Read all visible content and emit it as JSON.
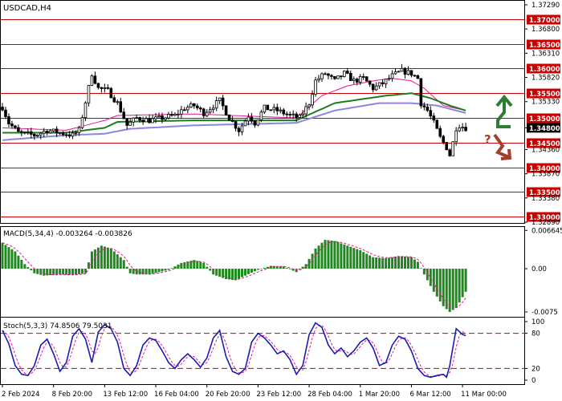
{
  "chart_data": {
    "type": "candlestick",
    "symbol": "USDCAD,H4",
    "main": {
      "ylim": [
        1.3289,
        1.3729
      ],
      "y_ticks": [
        "1.37290",
        "1.36800",
        "1.36310",
        "1.35820",
        "1.35330",
        "1.34800",
        "1.34360",
        "1.33870",
        "1.33380",
        "1.32890"
      ],
      "current_price": "1.34800",
      "levels": [
        {
          "value": 1.37,
          "label": "1.37000"
        },
        {
          "value": 1.365,
          "label": "1.36500"
        },
        {
          "value": 1.36,
          "label": "1.36000"
        },
        {
          "value": 1.355,
          "label": "1.35500"
        },
        {
          "value": 1.35,
          "label": "1.35000"
        },
        {
          "value": 1.345,
          "label": "1.34500"
        },
        {
          "value": 1.34,
          "label": "1.34000"
        },
        {
          "value": 1.335,
          "label": "1.33500"
        },
        {
          "value": 1.33,
          "label": "1.33000"
        }
      ],
      "close_anchors": [
        [
          0,
          1.3522
        ],
        [
          2,
          1.349
        ],
        [
          5,
          1.347
        ],
        [
          10,
          1.3465
        ],
        [
          14,
          1.3475
        ],
        [
          18,
          1.347
        ],
        [
          22,
          1.3465
        ],
        [
          24,
          1.3475
        ],
        [
          28,
          1.359
        ],
        [
          30,
          1.356
        ],
        [
          33,
          1.3555
        ],
        [
          36,
          1.353
        ],
        [
          39,
          1.3485
        ],
        [
          42,
          1.35
        ],
        [
          46,
          1.3495
        ],
        [
          50,
          1.35
        ],
        [
          54,
          1.3505
        ],
        [
          57,
          1.352
        ],
        [
          60,
          1.3525
        ],
        [
          63,
          1.351
        ],
        [
          66,
          1.3525
        ],
        [
          68,
          1.3535
        ],
        [
          71,
          1.35
        ],
        [
          74,
          1.3475
        ],
        [
          77,
          1.3505
        ],
        [
          79,
          1.349
        ],
        [
          82,
          1.352
        ],
        [
          86,
          1.3515
        ],
        [
          90,
          1.3505
        ],
        [
          93,
          1.35
        ],
        [
          96,
          1.353
        ],
        [
          98,
          1.3575
        ],
        [
          101,
          1.359
        ],
        [
          104,
          1.3575
        ],
        [
          107,
          1.359
        ],
        [
          110,
          1.3575
        ],
        [
          113,
          1.358
        ],
        [
          116,
          1.356
        ],
        [
          119,
          1.357
        ],
        [
          122,
          1.3585
        ],
        [
          125,
          1.3595
        ],
        [
          128,
          1.359
        ],
        [
          130,
          1.358
        ],
        [
          131,
          1.353
        ],
        [
          133,
          1.3515
        ],
        [
          135,
          1.349
        ],
        [
          137,
          1.346
        ],
        [
          139,
          1.344
        ],
        [
          140,
          1.3425
        ],
        [
          141,
          1.345
        ],
        [
          142,
          1.348
        ],
        [
          143,
          1.3485
        ],
        [
          145,
          1.348
        ]
      ],
      "ma_anchors": [
        {
          "name": "ma-red",
          "color": "#e8168e",
          "points": [
            [
              0,
              1.348
            ],
            [
              20,
              1.3475
            ],
            [
              32,
              1.3495
            ],
            [
              36,
              1.3505
            ],
            [
              60,
              1.3508
            ],
            [
              92,
              1.35
            ],
            [
              100,
              1.3545
            ],
            [
              108,
              1.3565
            ],
            [
              116,
              1.3575
            ],
            [
              122,
              1.358
            ],
            [
              128,
              1.3575
            ],
            [
              132,
              1.356
            ],
            [
              138,
              1.3525
            ],
            [
              145,
              1.3515
            ]
          ]
        },
        {
          "name": "ma-green",
          "color": "#1e7d1e",
          "points": [
            [
              0,
              1.347
            ],
            [
              20,
              1.347
            ],
            [
              32,
              1.348
            ],
            [
              36,
              1.3492
            ],
            [
              60,
              1.3495
            ],
            [
              92,
              1.3495
            ],
            [
              104,
              1.353
            ],
            [
              120,
              1.3545
            ],
            [
              128,
              1.355
            ],
            [
              134,
              1.354
            ],
            [
              140,
              1.3525
            ],
            [
              145,
              1.3515
            ]
          ]
        },
        {
          "name": "ma-blue",
          "color": "#8a86e0",
          "points": [
            [
              0,
              1.3455
            ],
            [
              20,
              1.3465
            ],
            [
              32,
              1.3468
            ],
            [
              40,
              1.3478
            ],
            [
              60,
              1.3485
            ],
            [
              92,
              1.349
            ],
            [
              104,
              1.3515
            ],
            [
              118,
              1.353
            ],
            [
              128,
              1.353
            ],
            [
              136,
              1.3525
            ],
            [
              145,
              1.351
            ]
          ]
        }
      ],
      "signal_up": "up-arrow",
      "signal_down": "down-arrow",
      "signal_question": "?"
    },
    "macd": {
      "label": "MACD(5,34,4) -0.003264 -0.003826",
      "ylim": [
        -0.0082,
        0.0071
      ],
      "y_ticks": [
        "0.006645",
        "0.00",
        "-0.0075"
      ],
      "bar_color": "#1e8a1e",
      "signal_color": "#e8168e",
      "anchors": [
        [
          0,
          0.0045
        ],
        [
          4,
          0.003
        ],
        [
          7,
          0.0008
        ],
        [
          10,
          -0.0008
        ],
        [
          13,
          -0.0012
        ],
        [
          18,
          -0.001
        ],
        [
          22,
          -0.0011
        ],
        [
          26,
          -0.0008
        ],
        [
          28,
          0.003
        ],
        [
          31,
          0.004
        ],
        [
          34,
          0.0035
        ],
        [
          38,
          0.0015
        ],
        [
          40,
          -0.0008
        ],
        [
          42,
          -0.001
        ],
        [
          46,
          -0.001
        ],
        [
          52,
          -0.0002
        ],
        [
          56,
          0.001
        ],
        [
          60,
          0.0015
        ],
        [
          63,
          0.001
        ],
        [
          66,
          -0.001
        ],
        [
          70,
          -0.0018
        ],
        [
          73,
          -0.002
        ],
        [
          76,
          -0.0012
        ],
        [
          80,
          -0.0002
        ],
        [
          84,
          0.0005
        ],
        [
          88,
          0.0004
        ],
        [
          92,
          -0.0006
        ],
        [
          95,
          0.0008
        ],
        [
          98,
          0.0035
        ],
        [
          101,
          0.005
        ],
        [
          104,
          0.0048
        ],
        [
          108,
          0.004
        ],
        [
          112,
          0.0032
        ],
        [
          116,
          0.002
        ],
        [
          120,
          0.0018
        ],
        [
          124,
          0.0022
        ],
        [
          128,
          0.002
        ],
        [
          130,
          0.0012
        ],
        [
          132,
          -0.001
        ],
        [
          135,
          -0.004
        ],
        [
          138,
          -0.0065
        ],
        [
          140,
          -0.0075
        ],
        [
          142,
          -0.0068
        ],
        [
          145,
          -0.004
        ]
      ]
    },
    "stoch": {
      "label": "Stoch(5,3,3) 74.8506 79.5031",
      "ylim": [
        0,
        100
      ],
      "y_ticks": [
        "100",
        "80",
        "20",
        "0"
      ],
      "levels": [
        80,
        20
      ],
      "k_color": "#1b1bb5",
      "d_color": "#e8168e",
      "anchors": [
        [
          0,
          85
        ],
        [
          2,
          62
        ],
        [
          4,
          25
        ],
        [
          6,
          10
        ],
        [
          8,
          8
        ],
        [
          10,
          25
        ],
        [
          12,
          60
        ],
        [
          14,
          70
        ],
        [
          16,
          45
        ],
        [
          18,
          15
        ],
        [
          20,
          30
        ],
        [
          22,
          75
        ],
        [
          24,
          88
        ],
        [
          26,
          70
        ],
        [
          28,
          30
        ],
        [
          30,
          82
        ],
        [
          32,
          95
        ],
        [
          34,
          88
        ],
        [
          36,
          65
        ],
        [
          38,
          20
        ],
        [
          40,
          8
        ],
        [
          42,
          25
        ],
        [
          44,
          60
        ],
        [
          46,
          72
        ],
        [
          48,
          68
        ],
        [
          50,
          50
        ],
        [
          52,
          30
        ],
        [
          54,
          20
        ],
        [
          56,
          35
        ],
        [
          58,
          45
        ],
        [
          60,
          35
        ],
        [
          62,
          22
        ],
        [
          64,
          38
        ],
        [
          66,
          72
        ],
        [
          68,
          85
        ],
        [
          70,
          40
        ],
        [
          72,
          15
        ],
        [
          74,
          10
        ],
        [
          76,
          20
        ],
        [
          78,
          65
        ],
        [
          80,
          80
        ],
        [
          82,
          72
        ],
        [
          84,
          60
        ],
        [
          86,
          45
        ],
        [
          88,
          50
        ],
        [
          90,
          35
        ],
        [
          92,
          10
        ],
        [
          94,
          25
        ],
        [
          96,
          78
        ],
        [
          98,
          98
        ],
        [
          100,
          90
        ],
        [
          102,
          60
        ],
        [
          104,
          45
        ],
        [
          106,
          55
        ],
        [
          108,
          40
        ],
        [
          110,
          50
        ],
        [
          112,
          65
        ],
        [
          114,
          72
        ],
        [
          116,
          55
        ],
        [
          118,
          25
        ],
        [
          120,
          30
        ],
        [
          122,
          60
        ],
        [
          124,
          75
        ],
        [
          126,
          70
        ],
        [
          128,
          50
        ],
        [
          130,
          20
        ],
        [
          132,
          8
        ],
        [
          134,
          5
        ],
        [
          136,
          8
        ],
        [
          138,
          10
        ],
        [
          139,
          5
        ],
        [
          140,
          25
        ],
        [
          142,
          88
        ],
        [
          144,
          78
        ],
        [
          145,
          76
        ]
      ]
    },
    "x_labels": [
      {
        "index": 0,
        "label": "2 Feb 2024"
      },
      {
        "index": 16,
        "label": "8 Feb 20:00"
      },
      {
        "index": 32,
        "label": "13 Feb 12:00"
      },
      {
        "index": 48,
        "label": "16 Feb 04:00"
      },
      {
        "index": 64,
        "label": "20 Feb 20:00"
      },
      {
        "index": 80,
        "label": "23 Feb 12:00"
      },
      {
        "index": 96,
        "label": "28 Feb 04:00"
      },
      {
        "index": 112,
        "label": "1 Mar 20:00"
      },
      {
        "index": 128,
        "label": "6 Mar 12:00"
      },
      {
        "index": 144,
        "label": "11 Mar 00:00"
      }
    ]
  }
}
